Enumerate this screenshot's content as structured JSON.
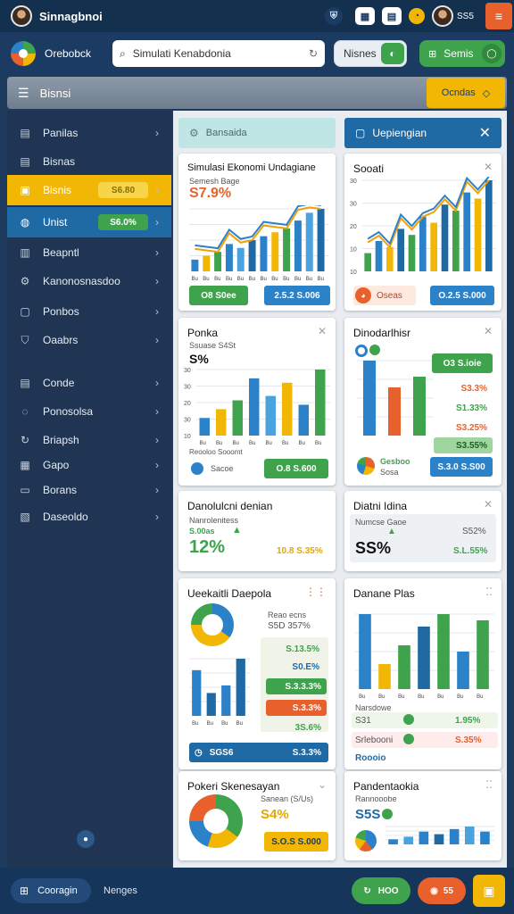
{
  "topbar": {
    "app_name": "Sinnagbnoi",
    "user_label": "SS5",
    "icons": [
      "shield-icon",
      "calendar-icon",
      "calendar-icon",
      "pie-icon",
      "menu-icon"
    ]
  },
  "subbar": {
    "brand": "Orebobck",
    "search_value": "Simulati Kenabdonia",
    "btn1": "Nisnes",
    "btn2": "Semis"
  },
  "sectionbar": {
    "title": "Bisnsi",
    "action": "Ocndas"
  },
  "sidebar": {
    "items": [
      {
        "label": "Panilas",
        "icon": "document-icon"
      },
      {
        "label": "Bisnas",
        "icon": "document-icon"
      },
      {
        "label": "Bisnis",
        "icon": "briefcase-icon",
        "badge": "S6.80"
      },
      {
        "label": "Unist",
        "icon": "globe-icon",
        "badge": "S6.0%"
      },
      {
        "label": "Beapntl",
        "icon": "layers-icon"
      },
      {
        "label": "Kanonosnasdoo",
        "icon": "settings-icon"
      },
      {
        "label": "Ponbos",
        "icon": "clipboard-icon"
      },
      {
        "label": "Oaabrs",
        "icon": "shield-icon"
      },
      {
        "label": "Conde",
        "icon": "document-icon"
      },
      {
        "label": "Ponosolsa",
        "icon": "chat-icon"
      },
      {
        "label": "Briapsh",
        "icon": "refresh-icon"
      },
      {
        "label": "Gapo",
        "icon": "grid-icon"
      },
      {
        "label": "Borans",
        "icon": "folder-icon"
      },
      {
        "label": "Daseoldo",
        "icon": "calendar-icon"
      }
    ]
  },
  "tabs": {
    "left": "Bansaida",
    "right": "Uepiengian"
  },
  "cards": {
    "c1": {
      "title": "Simulasi Ekonomi Undagiane",
      "subtitle": "Semesh Bage",
      "value": "S7.9%",
      "btn_left": "O8 S0ee",
      "btn_right": "2.5.2 S.006"
    },
    "c2": {
      "title": "Sooati",
      "yticks": [
        "30",
        "30",
        "20",
        "10",
        "10"
      ],
      "btn_left": "Oseas",
      "btn_right": "O.2.5 S.000"
    },
    "c3": {
      "title": "Ponka",
      "subtitle": "Ssuase S4St",
      "value": "S%",
      "yticks": [
        "30",
        "30",
        "20",
        "30",
        "10"
      ],
      "legend": "Reooloo Sooomt",
      "btn_left": "Sacoe",
      "btn_right": "O.8 S.600"
    },
    "c4": {
      "title": "Dinodarlhisr",
      "badge": "O3 S.ioie",
      "rows": [
        "S3.3%",
        "S1.33%",
        "S3.25%",
        "S3.55%"
      ],
      "legend1": "Gesboo",
      "legend2": "Sosa",
      "btn": "S.3.0 S.S00"
    },
    "c5": {
      "title": "Danolulcni denian",
      "subtitle": "Nanrolenitess",
      "line2": "S.00as",
      "value": "12%",
      "value_right": "10.8 S.35%"
    },
    "c6": {
      "title": "Diatni Idina",
      "subtitle": "Numcse Gaoe",
      "value": "SS%",
      "right1": "S52%",
      "right2": "S.L.55%"
    },
    "c7": {
      "title": "Ueekaitli Daepola",
      "label1": "Reao ecns",
      "label2": "S5D 357%",
      "rows": [
        "S.13.5%",
        "S0.E%",
        "S.3.3.3%",
        "S.3.3%",
        "3S.6%"
      ],
      "footer_left": "SGS6",
      "footer_right": "S.3.3%"
    },
    "c8": {
      "title": "Danane Plas",
      "label1": "Narsdowe",
      "label2": "S31",
      "value_right": "1.95%",
      "label3": "Srlebooni",
      "value_right2": "S.35%",
      "footer": "Roooio"
    },
    "c9": {
      "title": "Pokeri Skenesayan",
      "subtitle": "Sanean (S/Us)",
      "value": "S4%",
      "btn": "S.O.S S.000"
    },
    "c10": {
      "title": "Pandentaokia",
      "subtitle": "Rannooobe",
      "value": "S5S"
    }
  },
  "bottombar": {
    "left1": "Cooragin",
    "left2": "Nenges",
    "btn1": "HOO",
    "btn2": "55"
  },
  "colors": {
    "green": "#3fa34d",
    "blue": "#2b82c9",
    "orange": "#e8612c",
    "yellow": "#f2b705",
    "navy": "#1e3a5c"
  },
  "chart_data": [
    {
      "type": "bar",
      "title": "Simulasi Ekonomi Undagiane",
      "values": [
        6,
        8,
        10,
        14,
        12,
        16,
        18,
        20,
        22,
        26,
        30,
        32
      ]
    },
    {
      "type": "bar",
      "title": "Sooati",
      "values": [
        6,
        10,
        8,
        14,
        12,
        18,
        16,
        22,
        20,
        26,
        24,
        30
      ]
    },
    {
      "type": "bar",
      "title": "Ponka",
      "values": [
        8,
        12,
        16,
        26,
        18,
        24,
        14,
        30
      ]
    },
    {
      "type": "bar",
      "title": "Dinodarlhisr",
      "values": [
        28,
        18,
        22
      ]
    },
    {
      "type": "bar",
      "title": "Ueekaitli Daepola",
      "values": [
        24,
        12,
        16,
        30
      ]
    },
    {
      "type": "bar",
      "title": "Danane Plas",
      "values": [
        24,
        8,
        14,
        20,
        24,
        12,
        22
      ]
    },
    {
      "type": "bar",
      "title": "Pandentaokia",
      "values": [
        4,
        6,
        10,
        8,
        12,
        14,
        10
      ]
    }
  ]
}
